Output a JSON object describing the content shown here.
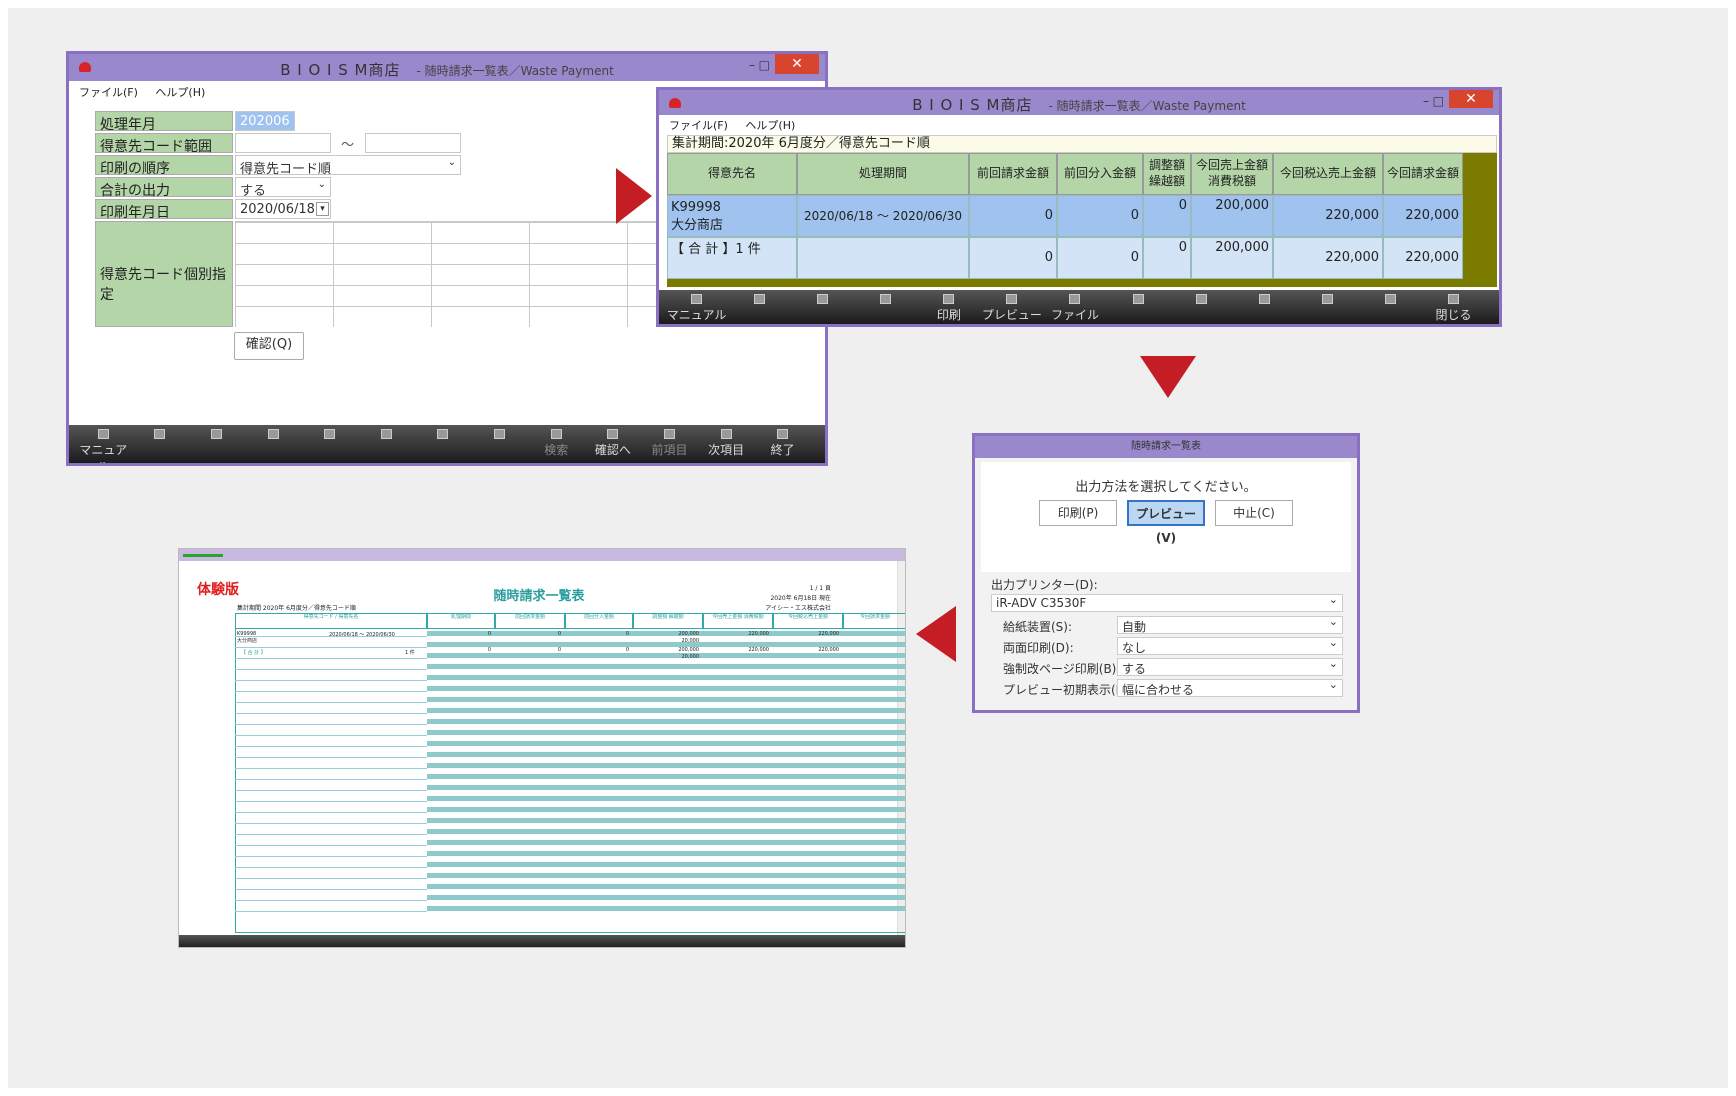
{
  "arrow_color": "#c41e24",
  "win1": {
    "title": "B I O I S M商店",
    "subtitle": "- 随時請求一覧表／Waste Payment",
    "controls": {
      "min": "–",
      "max": "□",
      "close": "✕"
    },
    "menu": [
      "ファイル(F)",
      "ヘルプ(H)"
    ],
    "fields": [
      {
        "label": "処理年月",
        "value": "202006"
      },
      {
        "label": "得意先コード範囲",
        "value": "",
        "range_sep": "～",
        "value2": ""
      },
      {
        "label": "印刷の順序",
        "value": "得意先コード順"
      },
      {
        "label": "合計の出力",
        "value": "する"
      },
      {
        "label": "印刷年月日",
        "value": "2020/06/18"
      }
    ],
    "individual_label": "得意先コード個別指定",
    "confirm_label": "確認(Q)",
    "footer": [
      {
        "label": "マニュアル",
        "icon": "manual-icon",
        "dim": false
      },
      {
        "label": "",
        "icon": "blank-icon",
        "dim": false
      },
      {
        "label": "",
        "icon": "blank-icon",
        "dim": false
      },
      {
        "label": "",
        "icon": "blank-icon",
        "dim": false
      },
      {
        "label": "",
        "icon": "blank-icon",
        "dim": false
      },
      {
        "label": "",
        "icon": "blank-icon",
        "dim": false
      },
      {
        "label": "",
        "icon": "blank-icon",
        "dim": false
      },
      {
        "label": "",
        "icon": "blank-icon",
        "dim": false
      },
      {
        "label": "検索",
        "icon": "search-icon",
        "dim": true
      },
      {
        "label": "確認へ",
        "icon": "confirm-icon",
        "dim": false
      },
      {
        "label": "前項目",
        "icon": "prev-icon",
        "dim": true
      },
      {
        "label": "次項目",
        "icon": "next-icon",
        "dim": false
      },
      {
        "label": "終了",
        "icon": "exit-icon",
        "dim": false
      }
    ]
  },
  "win2": {
    "title": "B I O I S M商店",
    "subtitle": "- 随時請求一覧表／Waste Payment",
    "controls": {
      "min": "–",
      "max": "□",
      "close": "✕"
    },
    "menu": [
      "ファイル(F)",
      "ヘルプ(H)"
    ],
    "period": "集計期間:2020年 6月度分／得意先コード順",
    "headers": [
      "得意先名",
      "処理期間",
      "前回請求金額",
      "前回分入金額",
      "調整額\n繰越額",
      "今回売上金額\n消費税額",
      "今回税込売上金額",
      "今回請求金額"
    ],
    "rows": [
      {
        "name1": "K99998",
        "name2": "大分商店",
        "period": "2020/06/18 ～ 2020/06/30",
        "prev": "0",
        "paid": "0",
        "adj": "0",
        "sales": "200,000",
        "taxin": "220,000",
        "bill": "220,000"
      },
      {
        "name1": "【 合 計 】1 件",
        "name2": "",
        "period": "",
        "prev": "0",
        "paid": "0",
        "adj": "0",
        "sales": "200,000",
        "taxin": "220,000",
        "bill": "220,000"
      }
    ],
    "footer": [
      {
        "label": "マニュアル",
        "icon": "manual-icon"
      },
      {
        "label": "",
        "icon": "blank-icon"
      },
      {
        "label": "",
        "icon": "blank-icon"
      },
      {
        "label": "",
        "icon": "blank-icon"
      },
      {
        "label": "印刷",
        "icon": "print-icon"
      },
      {
        "label": "プレビュー",
        "icon": "preview-icon"
      },
      {
        "label": "ファイル出...",
        "icon": "file-output-icon"
      },
      {
        "label": "",
        "icon": "blank-icon"
      },
      {
        "label": "",
        "icon": "blank-icon"
      },
      {
        "label": "",
        "icon": "blank-icon"
      },
      {
        "label": "",
        "icon": "blank-icon"
      },
      {
        "label": "",
        "icon": "blank-icon"
      },
      {
        "label": "閉じる",
        "icon": "close-icon"
      }
    ]
  },
  "dialog": {
    "title": "随時請求一覧表",
    "prompt": "出力方法を選択してください。",
    "buttons": [
      "印刷(P)",
      "プレビュー(V)",
      "中止(C)"
    ],
    "printer_label": "出力プリンター(D):",
    "printer": "iR-ADV C3530F",
    "options": [
      {
        "label": "給紙装置(S):",
        "value": "自動"
      },
      {
        "label": "両面印刷(D):",
        "value": "なし"
      },
      {
        "label": "強制改ページ印刷(B):",
        "value": "する"
      },
      {
        "label": "プレビュー初期表示(I):",
        "value": "幅に合わせる"
      }
    ]
  },
  "preview": {
    "trial": "体験版",
    "title": "随時請求一覧表",
    "page_no": "1 / 1 頁",
    "date": "2020年 6月18日 現在",
    "company": "アイシー・エス株式会社",
    "period": "集計期間 2020年 6月度分／得意先コード順",
    "headers": [
      "得意先コード / 得意先名",
      "処理期間",
      "前回請求金額",
      "前回分入金額",
      "調整額 繰越額",
      "今回売上金額 消費税額",
      "今回税込売上金額",
      "今回請求金額"
    ],
    "row1": {
      "code": "K99998",
      "name": "大分商店",
      "period": "2020/06/18 ～ 2020/06/30"
    },
    "total_label": "【 合 計 】",
    "total_count": "1 件",
    "values": {
      "prev": "0",
      "paid": "0",
      "adj": "0",
      "sales": "200,000",
      "tax": "20,000",
      "taxin": "220,000",
      "bill": "220,000"
    }
  }
}
